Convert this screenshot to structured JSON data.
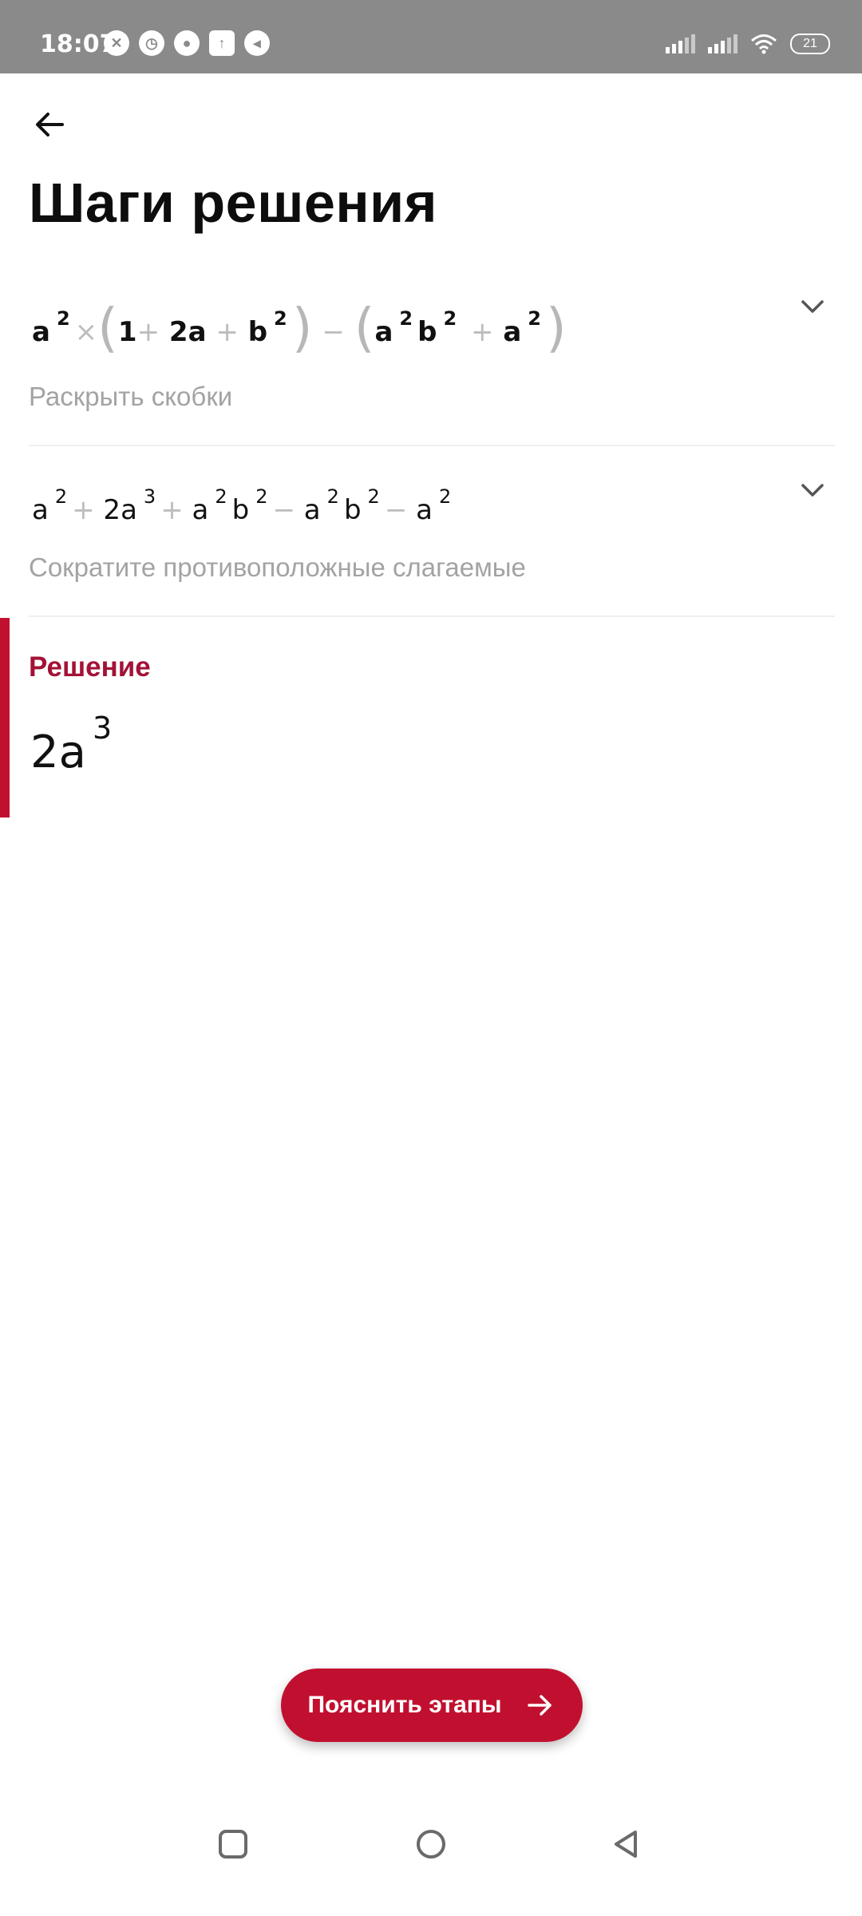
{
  "status": {
    "time": "18:07",
    "battery": "21"
  },
  "header": {
    "title": "Шаги решения"
  },
  "steps": [
    {
      "description": "Раскрыть скобки"
    },
    {
      "description": "Сократите противоположные слагаемые"
    }
  ],
  "solution": {
    "label": "Решение",
    "base": "2a",
    "exponent": "3"
  },
  "action": {
    "label": "Пояснить этапы"
  },
  "colors": {
    "accent": "#c1102f",
    "accent_text": "#a31236",
    "status_bar": "#8a8a8a",
    "muted_text": "#a3a3a3"
  },
  "icons": {
    "back": "arrow-left-icon",
    "expand": "chevron-down-icon",
    "action": "arrow-right-icon",
    "nav_recents": "square-icon",
    "nav_home": "circle-icon",
    "nav_back": "triangle-back-icon"
  }
}
